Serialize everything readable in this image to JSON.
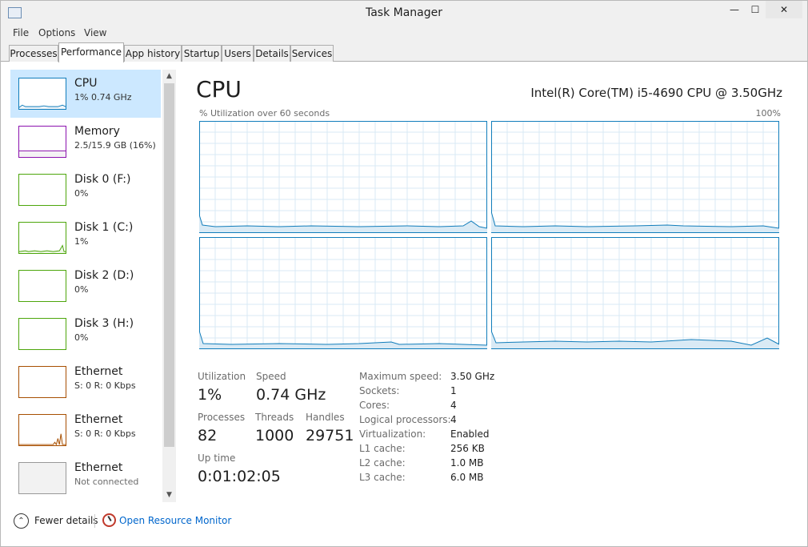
{
  "window": {
    "title": "Task Manager",
    "controls": {
      "minimize": "—",
      "maximize": "☐",
      "close": "✕"
    }
  },
  "menu": [
    "File",
    "Options",
    "View"
  ],
  "tabs": [
    "Processes",
    "Performance",
    "App history",
    "Startup",
    "Users",
    "Details",
    "Services"
  ],
  "active_tab": "Performance",
  "sidebar": {
    "items": [
      {
        "name": "CPU",
        "sub": "1% 0.74 GHz",
        "color": "#117dbb",
        "fill": "#f1f6fa",
        "selected": true
      },
      {
        "name": "Memory",
        "sub": "2.5/15.9 GB (16%)",
        "color": "#8b12ae",
        "fill": "#f4f2f4",
        "selected": false
      },
      {
        "name": "Disk 0 (F:)",
        "sub": "0%",
        "color": "#4da60c",
        "fill": "#eff7e8",
        "selected": false
      },
      {
        "name": "Disk 1 (C:)",
        "sub": "1%",
        "color": "#4da60c",
        "fill": "#eff7e8",
        "selected": false
      },
      {
        "name": "Disk 2 (D:)",
        "sub": "0%",
        "color": "#4da60c",
        "fill": "#eff7e8",
        "selected": false
      },
      {
        "name": "Disk 3 (H:)",
        "sub": "0%",
        "color": "#4da60c",
        "fill": "#eff7e8",
        "selected": false
      },
      {
        "name": "Ethernet",
        "sub": "S: 0 R: 0 Kbps",
        "color": "#a74f01",
        "fill": "#fcf3eb",
        "selected": false
      },
      {
        "name": "Ethernet",
        "sub": "S: 0 R: 0 Kbps",
        "color": "#a74f01",
        "fill": "#fcf3eb",
        "selected": false
      },
      {
        "name": "Ethernet",
        "sub": "Not connected",
        "color": "#999999",
        "fill": "#f0f0f0",
        "selected": false
      }
    ],
    "scroll_up": "▲",
    "scroll_down": "▼"
  },
  "main": {
    "title": "CPU",
    "model": "Intel(R) Core(TM) i5-4690 CPU @ 3.50GHz",
    "graph_caption": "% Utilization over 60 seconds",
    "graph_max": "100%",
    "graph_color": "#117dbb",
    "graph_fill": "#d9eaf5",
    "stats": {
      "utilization_label": "Utilization",
      "utilization": "1%",
      "speed_label": "Speed",
      "speed": "0.74 GHz",
      "processes_label": "Processes",
      "processes": "82",
      "threads_label": "Threads",
      "threads": "1000",
      "handles_label": "Handles",
      "handles": "29751",
      "uptime_label": "Up time",
      "uptime": "0:01:02:05"
    },
    "specs": [
      {
        "label": "Maximum speed:",
        "value": "3.50 GHz"
      },
      {
        "label": "Sockets:",
        "value": "1"
      },
      {
        "label": "Cores:",
        "value": "4"
      },
      {
        "label": "Logical processors:",
        "value": "4"
      },
      {
        "label": "Virtualization:",
        "value": "Enabled"
      },
      {
        "label": "L1 cache:",
        "value": "256 KB"
      },
      {
        "label": "L2 cache:",
        "value": "1.0 MB"
      },
      {
        "label": "L3 cache:",
        "value": "6.0 MB"
      }
    ]
  },
  "footer": {
    "fewer_icon": "⌃",
    "fewer_details": "Fewer details",
    "open_resource_monitor": "Open Resource Monitor"
  }
}
